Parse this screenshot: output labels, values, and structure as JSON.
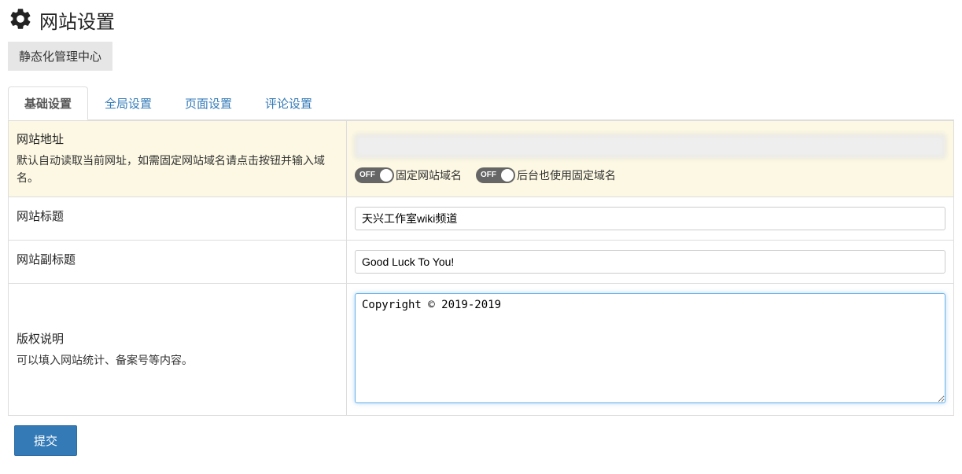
{
  "header": {
    "title": "网站设置",
    "subButton": "静态化管理中心"
  },
  "tabs": [
    {
      "label": "基础设置",
      "active": true
    },
    {
      "label": "全局设置",
      "active": false
    },
    {
      "label": "页面设置",
      "active": false
    },
    {
      "label": "评论设置",
      "active": false
    }
  ],
  "fields": {
    "siteUrl": {
      "label": "网站地址",
      "help": "默认自动读取当前网址，如需固定网站域名请点击按钮并输入域名。",
      "value": "",
      "toggle1": {
        "state": "OFF",
        "label": "固定网站域名"
      },
      "toggle2": {
        "state": "OFF",
        "label": "后台也使用固定域名"
      }
    },
    "siteTitle": {
      "label": "网站标题",
      "value": "天兴工作室wiki频道"
    },
    "siteSubtitle": {
      "label": "网站副标题",
      "value": "Good Luck To You!"
    },
    "copyright": {
      "label": "版权说明",
      "help": "可以填入网站统计、备案号等内容。",
      "value": "Copyright © 2019-2019"
    }
  },
  "submit": {
    "label": "提交"
  }
}
